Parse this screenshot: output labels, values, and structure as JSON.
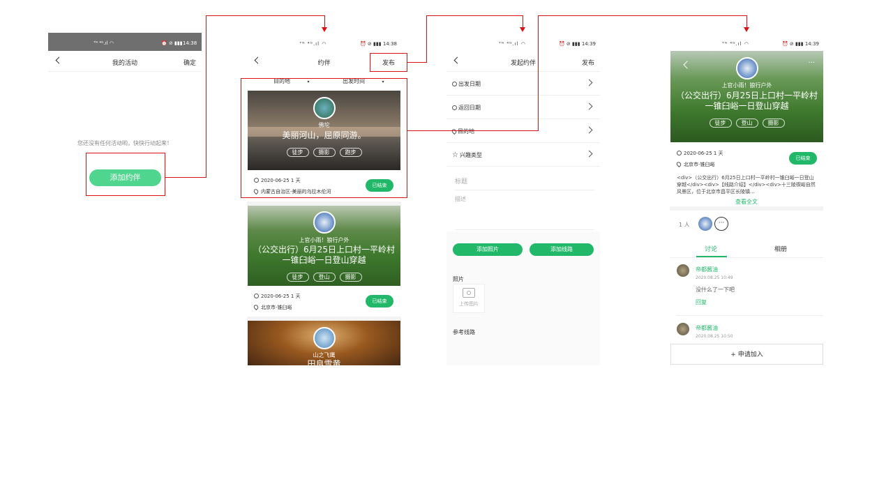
{
  "status": {
    "left": "ᵀᴺ ⁴ᴳ.ıl ◠",
    "time1": "14:38",
    "time2": "14:38",
    "time3": "14:39",
    "time4": "14:39",
    "right_icons": "⏰ ⊘ ▮▮▮"
  },
  "screen1": {
    "back": "<",
    "title": "我的活动",
    "confirm": "确定",
    "empty_text": "您还没有任何活动哟，快快行动起来！",
    "add_button": "添加约伴"
  },
  "screen2": {
    "title": "约伴",
    "publish": "发布",
    "filter_destination": "目的地",
    "filter_time": "出发时间",
    "cards": [
      {
        "org": "佛坨",
        "title": "美丽河山，屈原同游。",
        "tags": [
          "徒步",
          "摄影",
          "跑步"
        ],
        "date": "2020-06-25  1 天",
        "place": "内蒙古自治区-美丽的乌拉木伦河",
        "status": "已结束"
      },
      {
        "org": "上官小雨！狼行户外",
        "title": "（公交出行）6月25日上口村一平岭村一锥臼峪一日登山穿越",
        "tags": [
          "徒步",
          "登山",
          "摄影"
        ],
        "date": "2020-06-25  1 天",
        "place": "北京市-锥臼峪",
        "status": "已结束"
      },
      {
        "org": "山之飞鹰",
        "title": "田良雪黄"
      }
    ]
  },
  "screen3": {
    "title": "发起约伴",
    "publish": "发布",
    "rows": [
      "出发日期",
      "返回日期",
      "目的地",
      "兴趣类型"
    ],
    "title_placeholder": "标题",
    "desc_placeholder": "描述",
    "add_photo": "添加照片",
    "add_route": "添加线路",
    "photos_label": "照片",
    "upload_photo": "上传图片",
    "route_label": "参考线路"
  },
  "screen4": {
    "org": "上官小雨！狼行户外",
    "title": "（公交出行）6月25日上口村一平岭村一锥臼峪一日登山穿越",
    "tags": [
      "徒步",
      "登山",
      "摄影"
    ],
    "date": "2020-06-25  1 天",
    "place": "北京市-锥臼峪",
    "status": "已结束",
    "description": "<div>（公交出行）6月25日上口村一平岭村一锥臼峪一日登山穿越</div><div>【线路介绍】</div><div>十三陵禊峪自然风景区，位于北京市昌平区长陵镇...",
    "read_more": "查看全文",
    "members_count": "1 人",
    "more": "···",
    "tab_discuss": "讨论",
    "tab_album": "相册",
    "comments": [
      {
        "user": "帝都酱油",
        "time": "2020.08.25 10:49",
        "text": "没什么了一下吧",
        "reply": "回复"
      },
      {
        "user": "帝都酱油",
        "time": "2020.08.25 10:50"
      }
    ],
    "join": "+ 申请加入",
    "menu": "···"
  },
  "colors": {
    "accent": "#22b86a",
    "annotation": "#dd1111"
  }
}
